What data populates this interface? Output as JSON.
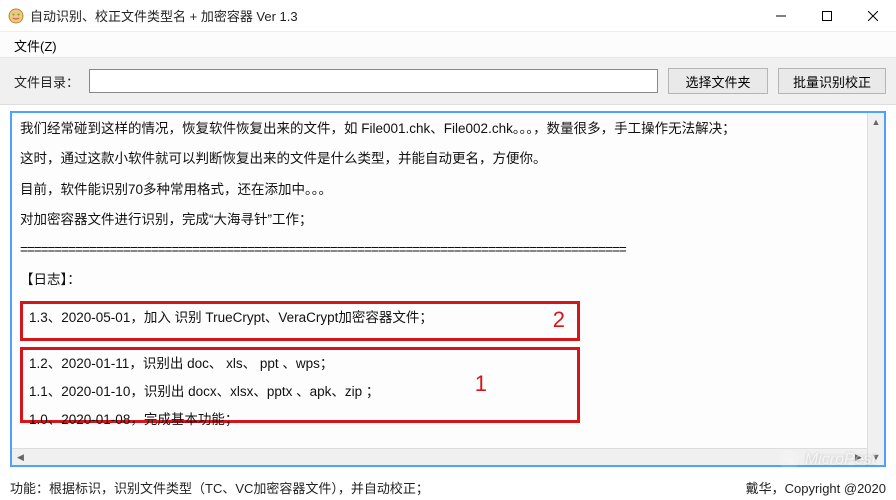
{
  "window": {
    "title": "自动识别、校正文件类型名 + 加密容器 Ver 1.3"
  },
  "menu": {
    "file": "文件(Z)"
  },
  "toolbar": {
    "dir_label": "文件目录：",
    "dir_value": "",
    "choose_label": "选择文件夹",
    "batch_label": "批量识别校正"
  },
  "body": {
    "p1": "我们经常碰到这样的情况，恢复软件恢复出来的文件，如 File001.chk、File002.chk。。。，数量很多，手工操作无法解决；",
    "p2": "这时，通过这款小软件就可以判断恢复出来的文件是什么类型，并能自动更名，方便你。",
    "p3": "目前，软件能识别70多种常用格式，还在添加中。。。",
    "p4": "对加密容器文件进行识别，完成“大海寻针”工作；",
    "sep": "========================================================================================",
    "log_heading": "【日志】：",
    "changelog_a": {
      "e1": "1.3、2020-05-01，加入 识别 TrueCrypt、VeraCrypt加密容器文件；"
    },
    "changelog_b": {
      "e1": "1.2、2020-01-11，识别出 doc、  xls、  ppt 、wps；",
      "e2": "1.1、2020-01-10，识别出 docx、xlsx、pptx 、apk、zip ；",
      "e3": "1.0、2020-01-08，完成基本功能；"
    },
    "anno1": "1",
    "anno2": "2"
  },
  "status": {
    "left": "功能：根据标识，识别文件类型（TC、VC加密容器文件），并自动校正；",
    "right": "戴华，Copyright @2020"
  },
  "watermark": {
    "text": "MicroPest"
  }
}
